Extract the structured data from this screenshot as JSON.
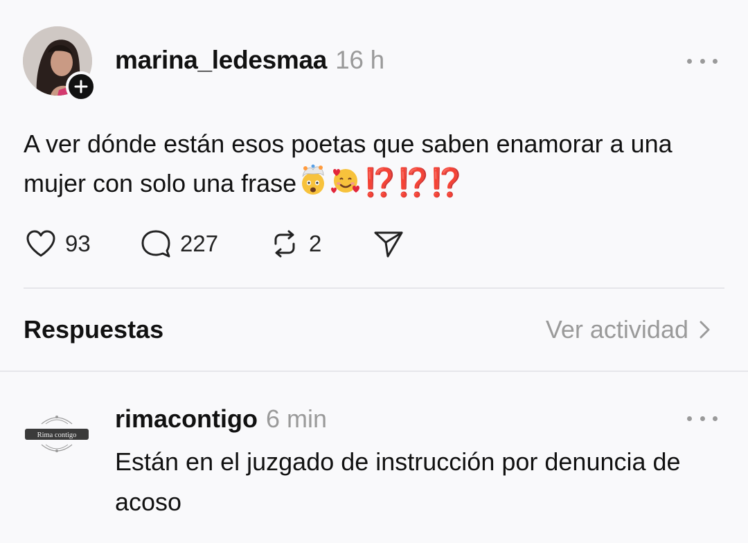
{
  "post": {
    "username": "marina_ledesmaa",
    "timestamp": "16 h",
    "text": "A ver dónde están esos poetas que saben enamorar a una mujer con solo una frase",
    "emoji_suffix": [
      "exploding-head-emoji",
      "smiling-face-with-hearts-emoji"
    ],
    "exclamations": "⁉️⁉️⁉️",
    "likes": "93",
    "replies": "227",
    "reposts": "2"
  },
  "replies_section": {
    "title": "Respuestas",
    "view_activity_label": "Ver actividad"
  },
  "reply": {
    "username": "rimacontigo",
    "timestamp": "6 min",
    "avatar_text": "Rima contigo",
    "text": "Están en el juzgado de instrucción por denuncia de acoso"
  },
  "colors": {
    "background": "#f9f9fb",
    "text": "#111111",
    "muted": "#9a9a9a",
    "divider": "#e6e6ea",
    "exclaim_red": "#d8202a"
  }
}
